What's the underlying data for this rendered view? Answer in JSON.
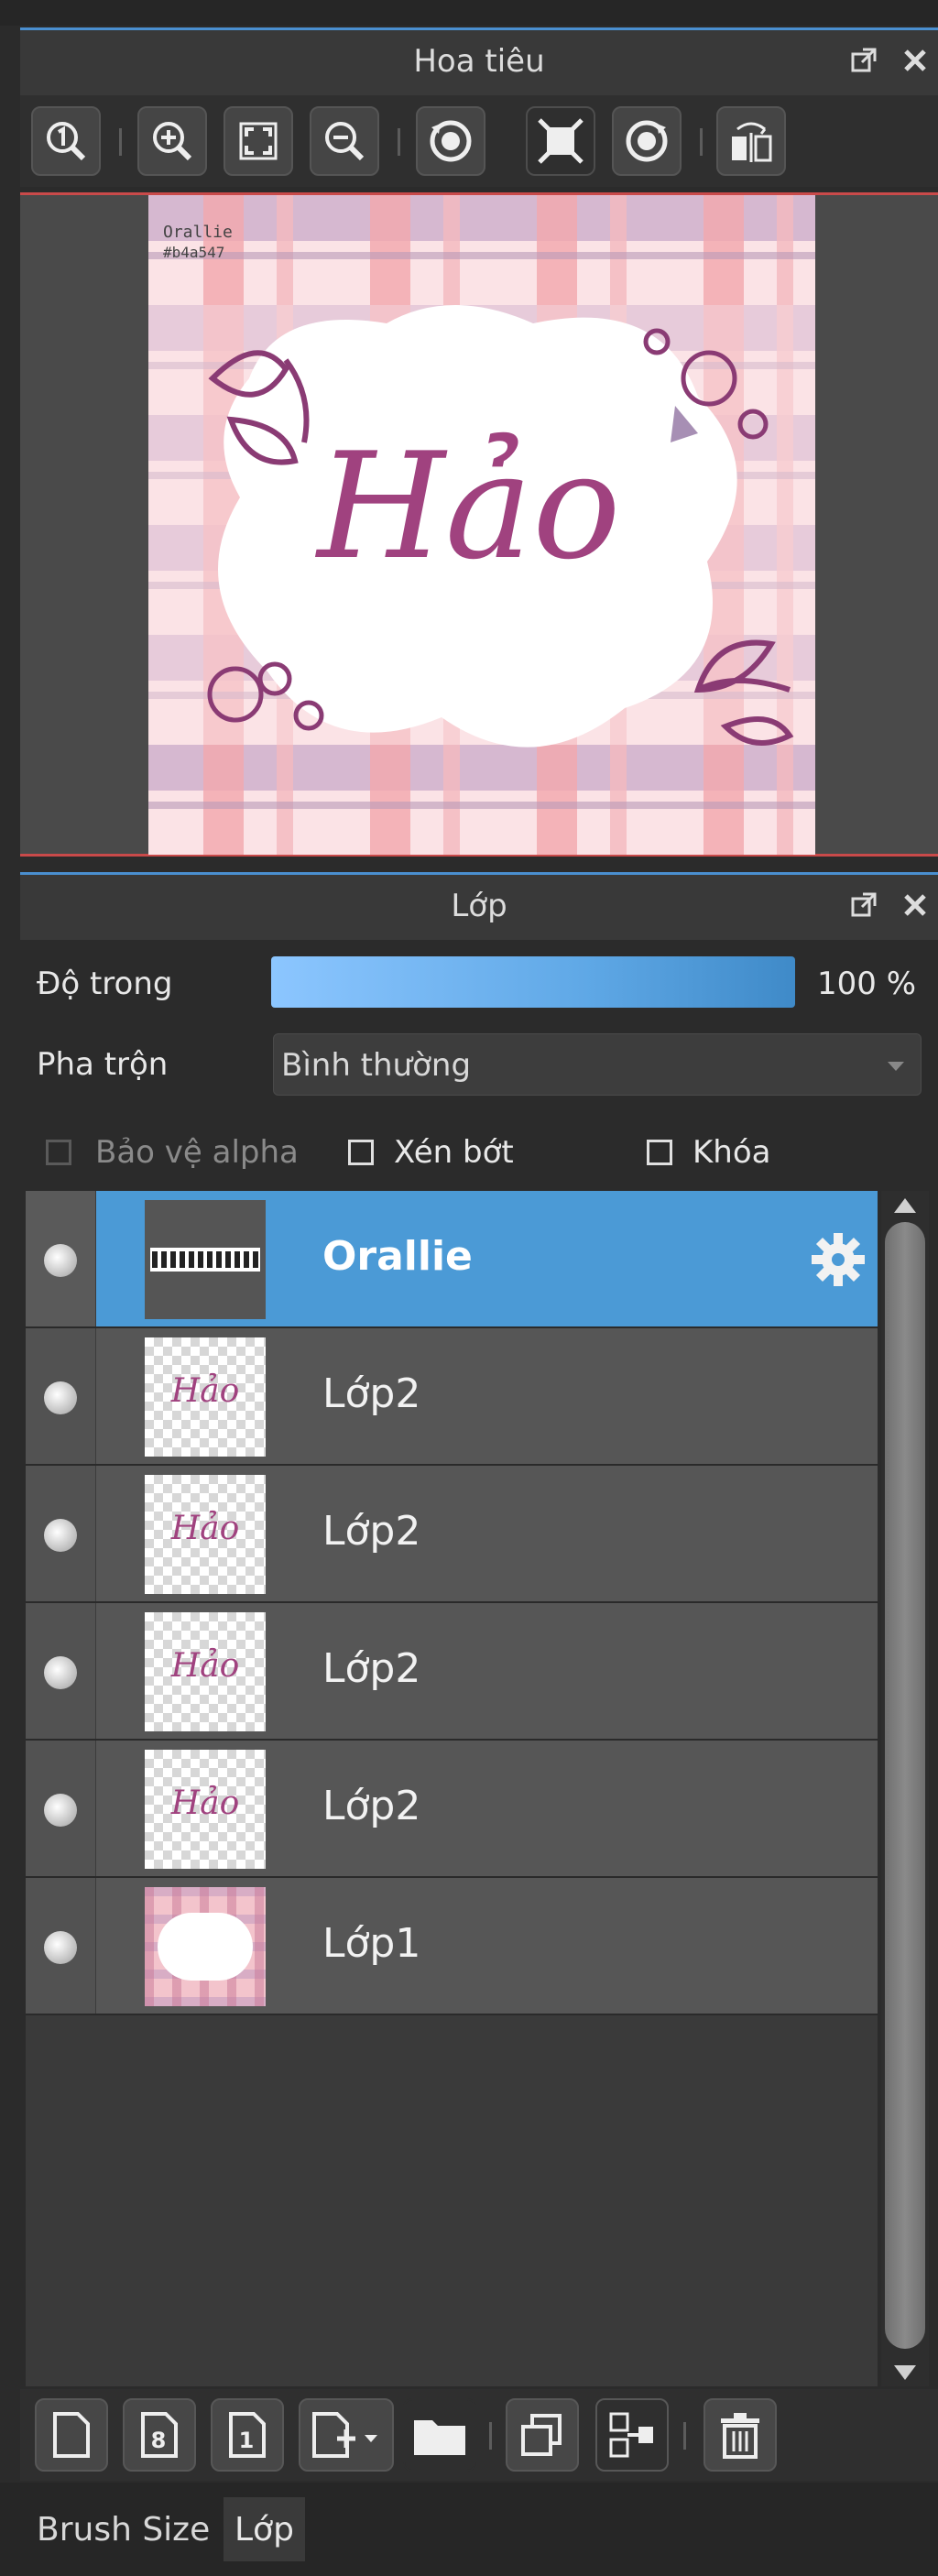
{
  "navigator": {
    "title": "Hoa tiêu",
    "canvas_text": "Orallie",
    "canvas_hex": "#b4a547",
    "art_text": "Hảo",
    "accent_color": "#4a8fd0",
    "frame_color": "#c94a4a"
  },
  "layer_panel": {
    "title": "Lớp",
    "opacity_label": "Độ trong",
    "opacity_value": "100 %",
    "blend_label": "Pha trộn",
    "blend_value": "Bình thường",
    "protect_alpha_label": "Bảo vệ alpha",
    "clipping_label": "Xén bớt",
    "lock_label": "Khóa",
    "selected_color": "#4b9ad6"
  },
  "layers": [
    {
      "name": "Orallie",
      "selected": true,
      "thumb": "text"
    },
    {
      "name": "Lớp2",
      "selected": false,
      "thumb": "hao"
    },
    {
      "name": "Lớp2",
      "selected": false,
      "thumb": "hao"
    },
    {
      "name": "Lớp2",
      "selected": false,
      "thumb": "hao"
    },
    {
      "name": "Lớp2",
      "selected": false,
      "thumb": "hao"
    },
    {
      "name": "Lớp1",
      "selected": false,
      "thumb": "plaid"
    }
  ],
  "thumb_text": "Hảo",
  "bottom_tabs": {
    "brush_size": "Brush Size",
    "layer": "Lớp"
  }
}
